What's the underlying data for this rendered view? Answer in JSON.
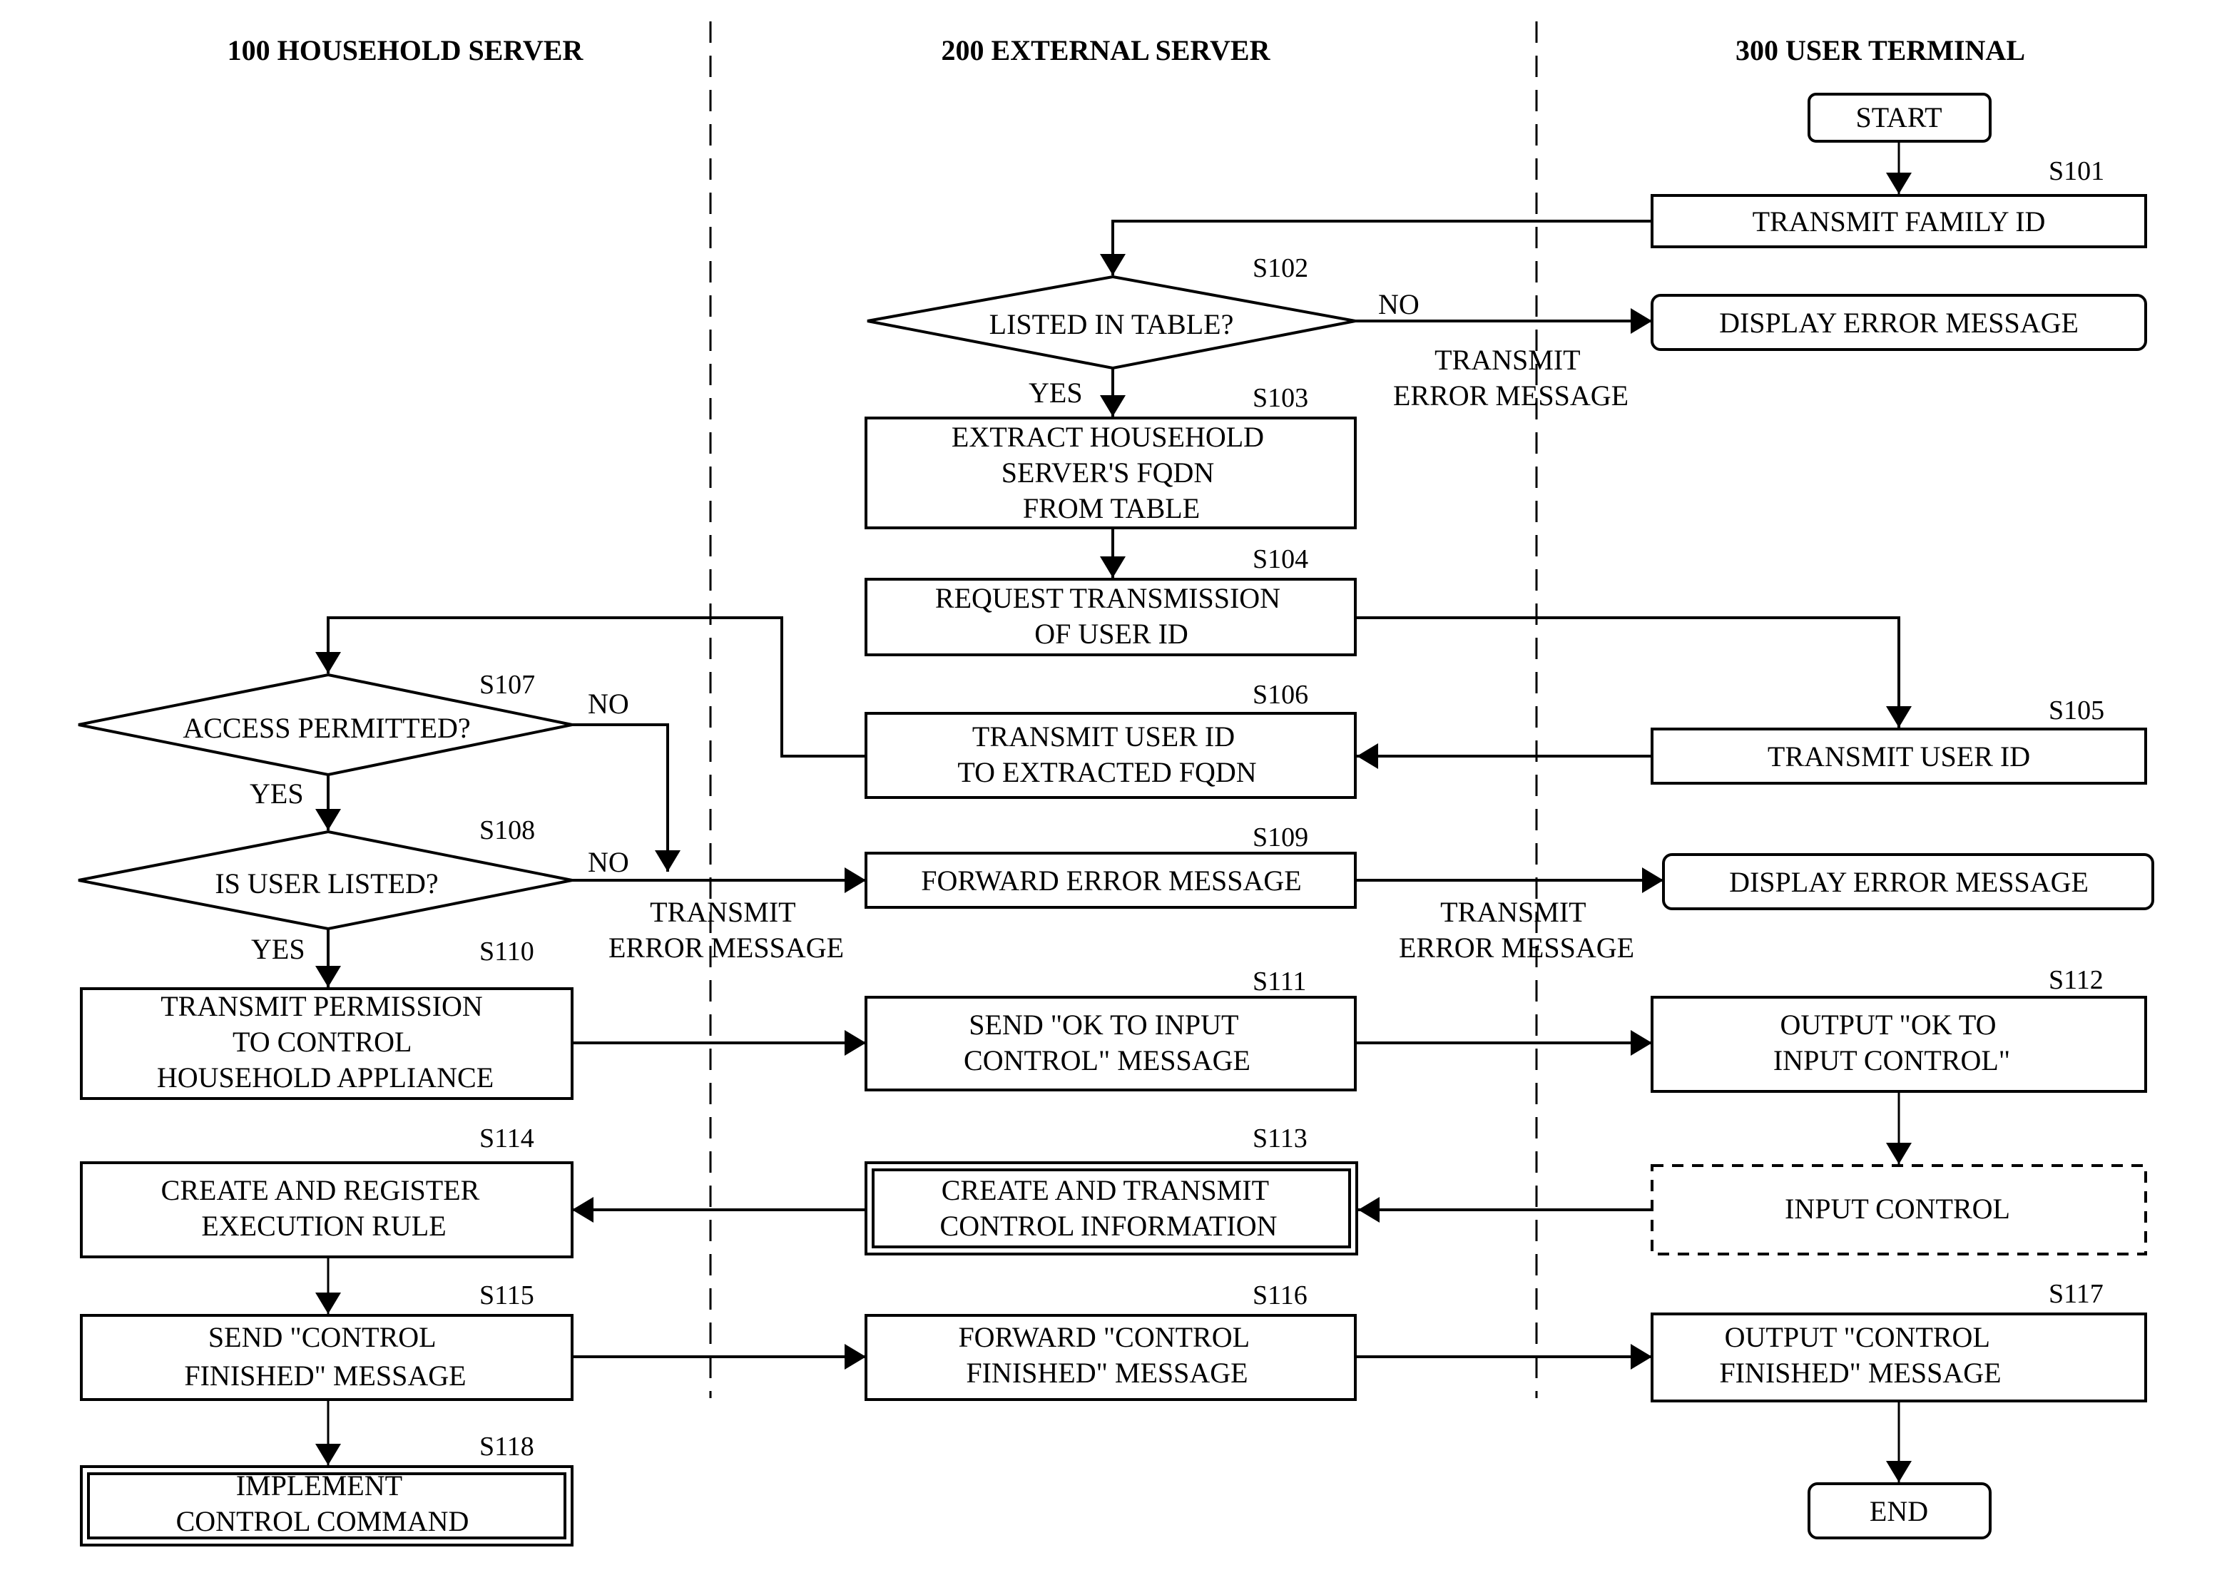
{
  "lanes": [
    {
      "id": "100",
      "title": "100 HOUSEHOLD SERVER"
    },
    {
      "id": "200",
      "title": "200 EXTERNAL SERVER"
    },
    {
      "id": "300",
      "title": "300 USER TERMINAL"
    }
  ],
  "nodes": {
    "start": {
      "lines": [
        "START"
      ]
    },
    "s101": {
      "step": "S101",
      "lines": [
        "TRANSMIT FAMILY ID"
      ]
    },
    "s102": {
      "step": "S102",
      "lines": [
        "LISTED IN TABLE?"
      ]
    },
    "err1": {
      "lines": [
        "DISPLAY ERROR MESSAGE"
      ]
    },
    "s103": {
      "step": "S103",
      "lines": [
        "EXTRACT HOUSEHOLD",
        "SERVER'S FQDN",
        "FROM TABLE"
      ]
    },
    "s104": {
      "step": "S104",
      "lines": [
        "REQUEST TRANSMISSION",
        "OF USER ID"
      ]
    },
    "s105": {
      "step": "S105",
      "lines": [
        "TRANSMIT USER ID"
      ]
    },
    "s106": {
      "step": "S106",
      "lines": [
        "TRANSMIT USER ID",
        "TO EXTRACTED FQDN"
      ]
    },
    "s107": {
      "step": "S107",
      "lines": [
        "ACCESS PERMITTED?"
      ]
    },
    "s108": {
      "step": "S108",
      "lines": [
        "IS USER LISTED?"
      ]
    },
    "s109": {
      "step": "S109",
      "lines": [
        "FORWARD ERROR MESSAGE"
      ]
    },
    "err2": {
      "lines": [
        "DISPLAY ERROR MESSAGE"
      ]
    },
    "s110": {
      "step": "S110",
      "lines": [
        "TRANSMIT PERMISSION",
        "TO CONTROL",
        "HOUSEHOLD APPLIANCE"
      ]
    },
    "s111": {
      "step": "S111",
      "lines": [
        "SEND \"OK TO INPUT",
        "CONTROL\" MESSAGE"
      ]
    },
    "s112": {
      "step": "S112",
      "lines": [
        "OUTPUT \"OK TO",
        "INPUT CONTROL\""
      ]
    },
    "input": {
      "lines": [
        "INPUT CONTROL"
      ]
    },
    "s113": {
      "step": "S113",
      "lines": [
        "CREATE AND TRANSMIT",
        "CONTROL INFORMATION"
      ]
    },
    "s114": {
      "step": "S114",
      "lines": [
        "CREATE AND REGISTER",
        "EXECUTION RULE"
      ]
    },
    "s115": {
      "step": "S115",
      "lines": [
        "SEND \"CONTROL",
        "FINISHED\" MESSAGE"
      ]
    },
    "s116": {
      "step": "S116",
      "lines": [
        "FORWARD \"CONTROL",
        "FINISHED\" MESSAGE"
      ]
    },
    "s117": {
      "step": "S117",
      "lines": [
        "OUTPUT \"CONTROL",
        "FINISHED\" MESSAGE"
      ]
    },
    "s118": {
      "step": "S118",
      "lines": [
        "IMPLEMENT",
        "CONTROL COMMAND"
      ]
    },
    "end": {
      "lines": [
        "END"
      ]
    }
  },
  "edge_labels": {
    "s102_no": "NO",
    "s102_yes": "YES",
    "s107_no": "NO",
    "s107_yes": "YES",
    "s108_no": "NO",
    "s108_yes": "YES",
    "transmit_error_1": [
      "TRANSMIT",
      "ERROR MESSAGE"
    ],
    "transmit_error_2": [
      "TRANSMIT",
      "ERROR MESSAGE"
    ],
    "transmit_error_3": [
      "TRANSMIT",
      "ERROR MESSAGE"
    ]
  }
}
